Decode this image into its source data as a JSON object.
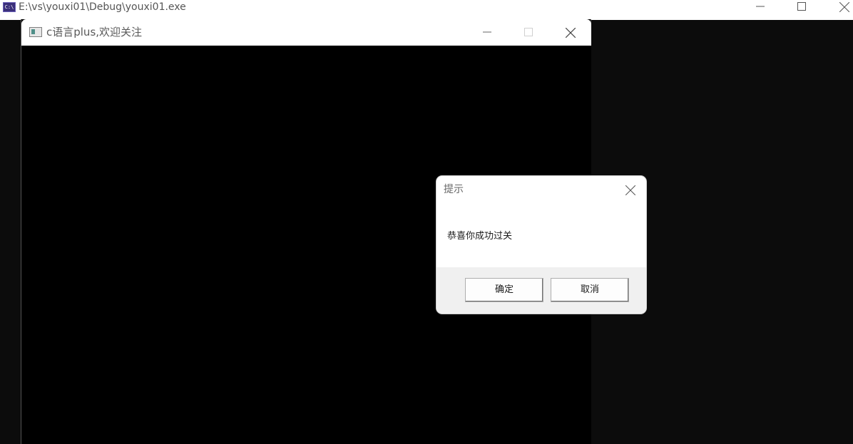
{
  "console": {
    "title": "E:\\vs\\youxi01\\Debug\\youxi01.exe",
    "icon_text": "C:\\"
  },
  "game_window": {
    "title": "c语言plus,欢迎关注"
  },
  "dialog": {
    "caption": "提示",
    "message": "恭喜你成功过关",
    "ok_label": "确定",
    "cancel_label": "取消"
  },
  "icons": [
    "console-app-icon",
    "minimize-icon",
    "maximize-icon",
    "close-icon",
    "window-app-icon"
  ]
}
